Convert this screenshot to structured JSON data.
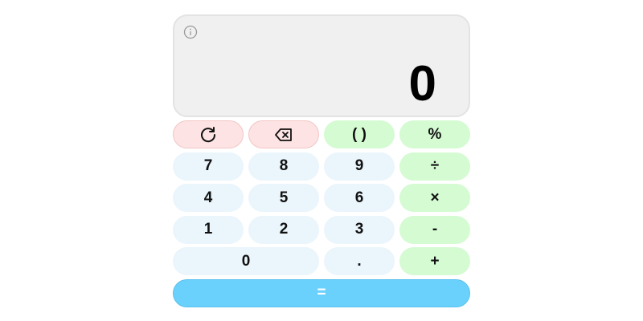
{
  "display": {
    "value": "0",
    "info_icon": "info-icon"
  },
  "keys": {
    "reset": {
      "icon": "refresh-icon"
    },
    "backspace": {
      "icon": "backspace-icon"
    },
    "parens": "( )",
    "percent": "%",
    "seven": "7",
    "eight": "8",
    "nine": "9",
    "divide": "÷",
    "four": "4",
    "five": "5",
    "six": "6",
    "multiply": "×",
    "one": "1",
    "two": "2",
    "three": "3",
    "minus": "-",
    "zero": "0",
    "decimal": ".",
    "plus": "+",
    "equals": "="
  },
  "colors": {
    "display_bg": "#f0f0f0",
    "number_key": "#eaf5fc",
    "operator_key": "#d5fbd3",
    "control_key": "#fde3e3",
    "equals_key": "#6ad1fc"
  }
}
